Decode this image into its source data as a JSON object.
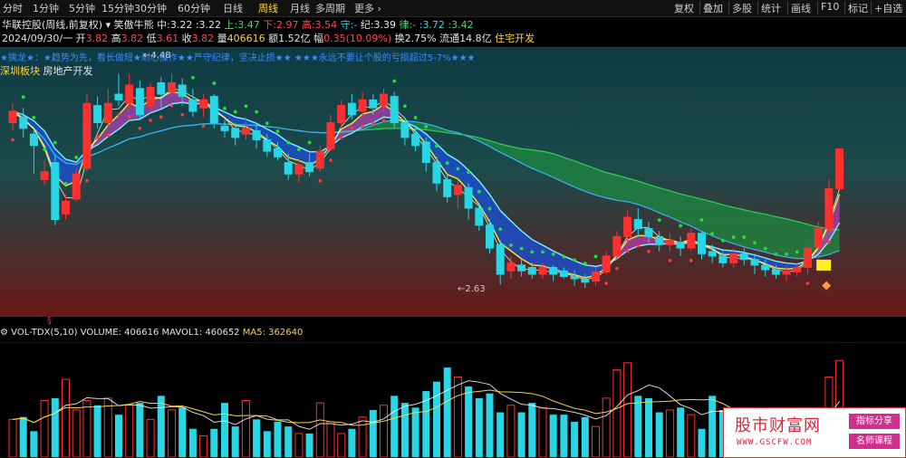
{
  "tabs": [
    "分时",
    "1分钟",
    "5分钟",
    "15分钟",
    "30分钟",
    "60分钟",
    "日线",
    "周线",
    "月线",
    "多周期",
    "更多"
  ],
  "active_tab": "周线",
  "right_buttons": [
    "复权",
    "叠加",
    "多股",
    "统计",
    "画线",
    "F10",
    "标记",
    "+自选"
  ],
  "header": {
    "stock_name": "华联控股(周线,前复权)",
    "indicator": "笑傲牛熊",
    "ind_values": [
      {
        "k": "中:",
        "v": "3.22"
      },
      {
        "k": ":",
        "v": "3.22"
      },
      {
        "k": "上:",
        "v": "3.47"
      },
      {
        "k": "下:",
        "v": "2.97"
      },
      {
        "k": "高:",
        "v": "3.54"
      },
      {
        "k": "守:",
        "v": "-"
      },
      {
        "k": "纪:",
        "v": "3.39"
      },
      {
        "k": "律:",
        "v": "-"
      },
      {
        "k": ":",
        "v": "3.72"
      },
      {
        "k": ":",
        "v": "3.42"
      }
    ],
    "date": "2024/09/30/一",
    "ohlc": [
      {
        "k": "开",
        "v": "3.82"
      },
      {
        "k": "高",
        "v": "3.82"
      },
      {
        "k": "低",
        "v": "3.61"
      },
      {
        "k": "收",
        "v": "3.82"
      },
      {
        "k": "量",
        "v": "406616"
      },
      {
        "k": "额",
        "v": "1.52亿"
      },
      {
        "k": "幅",
        "v": "0.35(10.09%)"
      },
      {
        "k": "换",
        "v": "2.75%"
      },
      {
        "k": "流通",
        "v": "14.8亿"
      }
    ],
    "sector_name": "住宅开发"
  },
  "banner_text": "★擒龙★：★趋势为先，看长做短★耐心操作★★严守纪律，坚决止损★★    ★★★永远不要让个股的亏损超过5-7%★★★",
  "sector_tag": {
    "label": "深圳板块",
    "value": "房地产开发"
  },
  "price_labels": {
    "high": "4.48",
    "low": "2.63"
  },
  "volume_header": {
    "name": "VOL-TDX(5,10)",
    "volume_label": "VOLUME:",
    "volume": "406616",
    "mavol_label": "MAVOL1:",
    "mavol": "460652",
    "ma5_label": "MA5:",
    "ma5": "362640"
  },
  "watermark": {
    "title": "股市财富网",
    "url": "WWW.GSCFW.COM",
    "btn1": "指标分享",
    "btn2": "名师课程"
  },
  "colors": {
    "up": "#ff3030",
    "down": "#28d6e6",
    "green_band": "#1e8a40",
    "blue_band": "#1a4fd0",
    "magenta": "#d040d0"
  },
  "chart_data": {
    "type": "candlestick",
    "period": "weekly",
    "candles": [
      [
        4.05,
        4.15,
        4.22,
        3.98
      ],
      [
        4.1,
        4.0,
        4.18,
        3.92
      ],
      [
        3.95,
        3.85,
        4.0,
        3.6
      ],
      [
        3.55,
        3.62,
        3.72,
        3.5
      ],
      [
        3.7,
        3.2,
        3.78,
        3.15
      ],
      [
        3.25,
        3.36,
        3.42,
        3.2
      ],
      [
        3.38,
        3.6,
        3.65,
        3.36
      ],
      [
        3.65,
        4.22,
        4.3,
        3.62
      ],
      [
        4.2,
        4.05,
        4.28,
        4.0
      ],
      [
        4.05,
        4.22,
        4.35,
        4.02
      ],
      [
        4.3,
        4.25,
        4.48,
        4.2
      ],
      [
        4.22,
        4.38,
        4.48,
        4.18
      ],
      [
        4.35,
        4.12,
        4.42,
        4.08
      ],
      [
        4.2,
        4.36,
        4.4,
        4.15
      ],
      [
        4.4,
        4.3,
        4.45,
        4.18
      ],
      [
        4.32,
        4.4,
        4.48,
        4.28
      ],
      [
        4.38,
        4.28,
        4.44,
        4.2
      ],
      [
        4.25,
        4.15,
        4.35,
        4.1
      ],
      [
        4.18,
        4.25,
        4.3,
        4.1
      ],
      [
        4.28,
        4.05,
        4.3,
        4.0
      ],
      [
        4.02,
        3.98,
        4.08,
        3.92
      ],
      [
        4.0,
        3.92,
        4.05,
        3.85
      ],
      [
        3.95,
        4.0,
        4.1,
        3.9
      ],
      [
        3.98,
        3.9,
        4.05,
        3.82
      ],
      [
        3.9,
        3.8,
        3.95,
        3.75
      ],
      [
        3.82,
        3.75,
        3.88,
        3.72
      ],
      [
        3.7,
        3.6,
        3.78,
        3.55
      ],
      [
        3.6,
        3.68,
        3.72,
        3.52
      ],
      [
        3.7,
        3.62,
        3.78,
        3.58
      ],
      [
        3.65,
        3.8,
        3.85,
        3.62
      ],
      [
        3.82,
        4.05,
        4.12,
        3.8
      ],
      [
        4.05,
        4.2,
        4.25,
        4.0
      ],
      [
        4.22,
        4.12,
        4.3,
        4.08
      ],
      [
        4.15,
        4.25,
        4.32,
        4.1
      ],
      [
        4.25,
        4.18,
        4.3,
        4.12
      ],
      [
        4.2,
        4.3,
        4.35,
        4.15
      ],
      [
        4.28,
        4.05,
        4.32,
        4.0
      ],
      [
        4.05,
        3.92,
        4.1,
        3.85
      ],
      [
        3.95,
        3.85,
        4.0,
        3.8
      ],
      [
        3.88,
        3.7,
        3.92,
        3.62
      ],
      [
        3.7,
        3.52,
        3.75,
        3.45
      ],
      [
        3.55,
        3.4,
        3.6,
        3.35
      ],
      [
        3.42,
        3.5,
        3.55,
        3.3
      ],
      [
        3.48,
        3.3,
        3.52,
        3.2
      ],
      [
        3.3,
        3.15,
        3.35,
        3.1
      ],
      [
        3.15,
        2.95,
        3.2,
        2.9
      ],
      [
        2.98,
        2.72,
        3.02,
        2.63
      ],
      [
        2.75,
        2.82,
        2.88,
        2.68
      ],
      [
        2.8,
        2.75,
        2.85,
        2.7
      ],
      [
        2.78,
        2.72,
        2.82,
        2.68
      ],
      [
        2.72,
        2.78,
        2.82,
        2.68
      ],
      [
        2.78,
        2.72,
        2.8,
        2.66
      ],
      [
        2.75,
        2.7,
        2.78,
        2.68
      ],
      [
        2.7,
        2.68,
        2.75,
        2.62
      ],
      [
        2.68,
        2.65,
        2.72,
        2.6
      ],
      [
        2.66,
        2.74,
        2.78,
        2.62
      ],
      [
        2.74,
        2.88,
        2.92,
        2.72
      ],
      [
        2.88,
        3.05,
        3.1,
        2.85
      ],
      [
        3.05,
        3.22,
        3.28,
        3.0
      ],
      [
        3.2,
        3.12,
        3.3,
        3.05
      ],
      [
        3.12,
        3.05,
        3.18,
        3.0
      ],
      [
        3.05,
        2.98,
        3.1,
        2.92
      ],
      [
        2.98,
        3.02,
        3.08,
        2.92
      ],
      [
        3.0,
        2.95,
        3.05,
        2.88
      ],
      [
        2.95,
        3.08,
        3.12,
        2.92
      ],
      [
        3.08,
        2.9,
        3.1,
        2.85
      ],
      [
        2.92,
        2.88,
        2.98,
        2.82
      ],
      [
        2.88,
        2.82,
        2.92,
        2.78
      ],
      [
        2.82,
        2.9,
        2.95,
        2.78
      ],
      [
        2.9,
        2.85,
        2.95,
        2.8
      ],
      [
        2.85,
        2.8,
        2.9,
        2.72
      ],
      [
        2.8,
        2.76,
        2.85,
        2.7
      ],
      [
        2.76,
        2.72,
        2.8,
        2.68
      ],
      [
        2.72,
        2.75,
        2.8,
        2.66
      ],
      [
        2.74,
        2.78,
        2.82,
        2.7
      ],
      [
        2.78,
        2.95,
        2.98,
        2.72
      ],
      [
        2.96,
        3.12,
        3.18,
        2.92
      ],
      [
        3.12,
        3.47,
        3.55,
        3.08
      ],
      [
        3.47,
        3.82,
        3.82,
        3.61
      ]
    ],
    "volume": [
      160,
      170,
      110,
      240,
      250,
      330,
      200,
      240,
      220,
      250,
      180,
      220,
      230,
      160,
      260,
      200,
      210,
      120,
      90,
      120,
      230,
      130,
      240,
      160,
      110,
      150,
      130,
      100,
      100,
      230,
      150,
      100,
      120,
      170,
      200,
      220,
      260,
      230,
      210,
      280,
      320,
      380,
      340,
      300,
      250,
      270,
      190,
      220,
      190,
      230,
      210,
      180,
      180,
      150,
      170,
      130,
      250,
      370,
      400,
      260,
      250,
      190,
      200,
      210,
      180,
      120,
      260,
      200,
      160,
      150,
      140,
      130,
      120,
      110,
      100,
      130,
      200,
      340,
      410
    ],
    "ylim": [
      2.45,
      4.65
    ],
    "volume_ylim": [
      0,
      480
    ]
  }
}
